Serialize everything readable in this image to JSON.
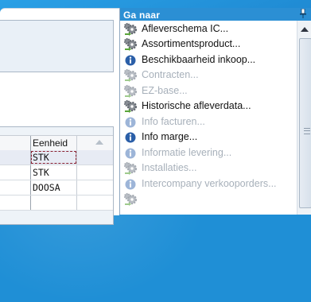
{
  "panel": {
    "title": "Ga naar",
    "items": [
      {
        "label": "Afleverschema IC...",
        "icon": "gear-pair-icon",
        "enabled": true
      },
      {
        "label": "Assortimentsproduct...",
        "icon": "gear-pair-icon",
        "enabled": true
      },
      {
        "label": "Beschikbaarheid inkoop...",
        "icon": "info-icon",
        "enabled": true
      },
      {
        "label": "Contracten...",
        "icon": "gear-pair-icon",
        "enabled": false
      },
      {
        "label": "EZ-base...",
        "icon": "gear-pair-icon",
        "enabled": false
      },
      {
        "label": "Historische afleverdata...",
        "icon": "gear-pair-icon",
        "enabled": true
      },
      {
        "label": "Info facturen...",
        "icon": "info-icon",
        "enabled": false
      },
      {
        "label": "Info marge...",
        "icon": "info-icon",
        "enabled": true
      },
      {
        "label": "Informatie levering...",
        "icon": "info-icon",
        "enabled": false
      },
      {
        "label": "Installaties...",
        "icon": "gear-pair-icon",
        "enabled": false
      },
      {
        "label": "Intercompany verkooporders...",
        "icon": "info-icon",
        "enabled": false
      },
      {
        "label": "",
        "icon": "gear-pair-icon",
        "enabled": false
      }
    ]
  },
  "grid": {
    "column_header": "Eenheid",
    "rows": [
      "STK",
      "STK",
      "DOOSA",
      ""
    ]
  },
  "colors": {
    "background": "#1f8fd6",
    "panel_title_text": "#ffffff",
    "info_icon": "#2b5fa8",
    "disabled_text": "#a7b0ba",
    "selection_outline": "#8a2233"
  }
}
